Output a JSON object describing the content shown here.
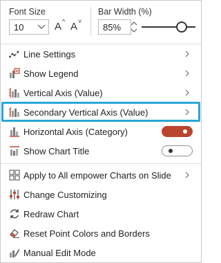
{
  "font_size": {
    "label": "Font Size",
    "value": "10",
    "increase_glyph": "A",
    "decrease_glyph": "A"
  },
  "bar_width": {
    "label": "Bar Width (%)",
    "value": "85%",
    "slider_percent": 85
  },
  "menu": {
    "line_settings": "Line Settings",
    "show_legend": "Show Legend",
    "vertical_axis": "Vertical Axis (Value)",
    "secondary_vertical_axis": "Secondary Vertical Axis (Value)",
    "horizontal_axis": "Horizontal Axis (Category)",
    "show_chart_title": "Show Chart Title",
    "apply_all": "Apply to All empower Charts on Slide",
    "change_customizing": "Change Customizing",
    "redraw_chart": "Redraw Chart",
    "reset_point_colors": "Reset Point Colors and Borders",
    "manual_edit_mode": "Manual Edit Mode"
  },
  "toggles": {
    "horizontal_axis_on": true,
    "show_chart_title_on": false
  },
  "colors": {
    "highlight": "#29a7d6",
    "toggle_on": "#b9452e"
  }
}
